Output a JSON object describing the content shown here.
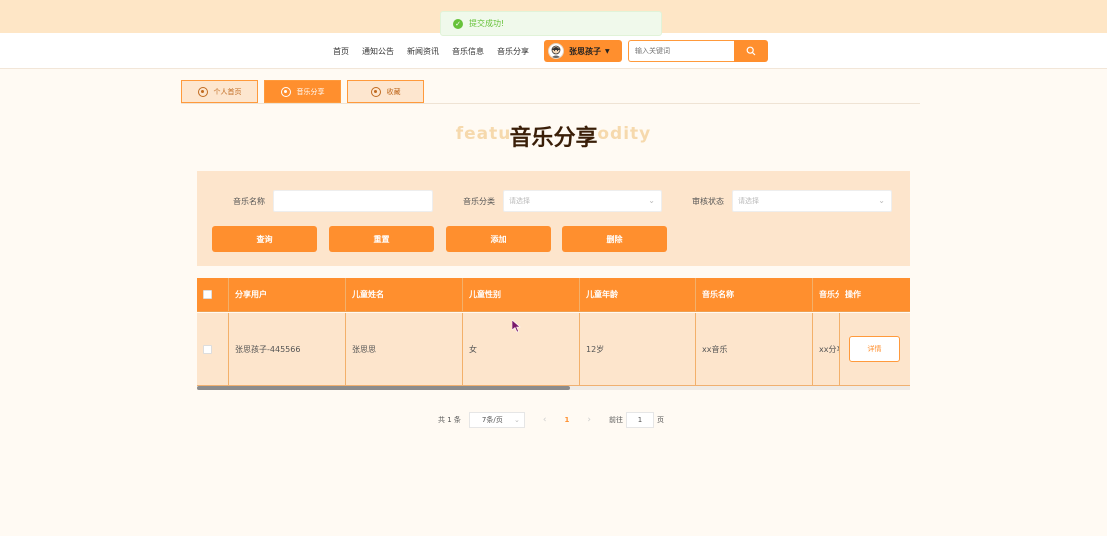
{
  "toast": {
    "message": "提交成功!",
    "icon": "success-check-icon",
    "color": "#67c23a"
  },
  "nav": {
    "links": [
      "首页",
      "通知公告",
      "新闻资讯",
      "音乐信息",
      "音乐分享"
    ],
    "user_name": "张思孩子",
    "search_placeholder": "输入关键词",
    "accent": "#ff8f2e"
  },
  "tabs": [
    {
      "label": "个人首页",
      "active": false
    },
    {
      "label": "音乐分享",
      "active": true
    },
    {
      "label": "收藏",
      "active": false
    }
  ],
  "title": {
    "main": "音乐分享",
    "background_left": "featu",
    "background_right": "odity"
  },
  "filter": {
    "music_name_label": "音乐名称",
    "music_name_value": "",
    "category_label": "音乐分类",
    "category_placeholder": "请选择",
    "status_label": "审核状态",
    "status_placeholder": "请选择",
    "buttons": {
      "query": "查询",
      "reset": "重置",
      "add": "添加",
      "delete": "删除"
    }
  },
  "table": {
    "headers": [
      "分享用户",
      "儿童姓名",
      "儿童性别",
      "儿童年龄",
      "音乐名称",
      "音乐分",
      "操作"
    ],
    "rows": [
      {
        "user": "张思孩子-445566",
        "child_name": "张思思",
        "gender": "女",
        "age": "12岁",
        "music": "xx音乐",
        "category": "xx分享",
        "action": "详情"
      }
    ]
  },
  "pager": {
    "total": "共 1 条",
    "page_size": "7条/页",
    "prev": "‹",
    "page": "1",
    "next": "›",
    "goto_prefix": "前往",
    "goto_value": "1",
    "goto_suffix": "页"
  }
}
